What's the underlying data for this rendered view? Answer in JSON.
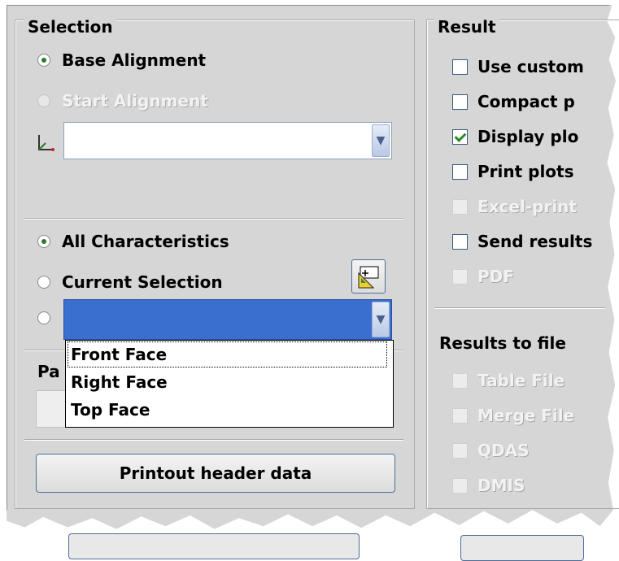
{
  "selection": {
    "title": "Selection",
    "base_alignment": "Base Alignment",
    "start_alignment": "Start Alignment",
    "alignment_combo_value": "",
    "all_characteristics": "All Characteristics",
    "current_selection": "Current Selection",
    "group_combo_value": "",
    "partial_label_fragment": "Pa",
    "printout_header_button": "Printout header data"
  },
  "dropdown": {
    "items": [
      "Front Face",
      "Right Face",
      "Top Face"
    ]
  },
  "result": {
    "title": "Result",
    "options": [
      {
        "label": "Use custom",
        "checked": false,
        "enabled": true
      },
      {
        "label": "Compact p",
        "checked": false,
        "enabled": true
      },
      {
        "label": "Display plo",
        "checked": true,
        "enabled": true
      },
      {
        "label": "Print plots",
        "checked": false,
        "enabled": true
      },
      {
        "label": "Excel-print",
        "checked": false,
        "enabled": false
      },
      {
        "label": "Send results",
        "checked": false,
        "enabled": true
      },
      {
        "label": "PDF",
        "checked": false,
        "enabled": false
      }
    ]
  },
  "results_to_file": {
    "title": "Results to file",
    "options": [
      {
        "label": "Table File",
        "enabled": false
      },
      {
        "label": "Merge File",
        "enabled": false
      },
      {
        "label": "QDAS",
        "enabled": false
      },
      {
        "label": "DMIS",
        "enabled": false
      }
    ]
  },
  "colors": {
    "panel": "#d6d6d6",
    "selected_highlight": "#3a6fcf",
    "checkbox_border": "#3b5a80"
  }
}
